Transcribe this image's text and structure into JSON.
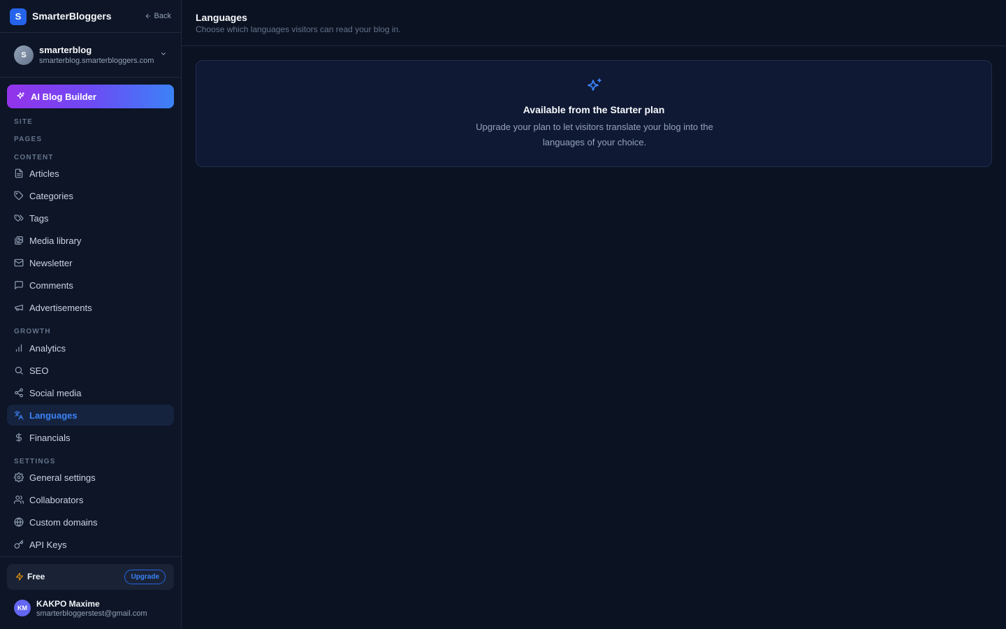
{
  "brand": {
    "logo_letter": "S",
    "name": "SmarterBloggers",
    "back_label": "Back"
  },
  "site": {
    "avatar_letter": "S",
    "name": "smarterblog",
    "domain": "smarterblog.smarterbloggers.com"
  },
  "ai_button": {
    "label": "AI Blog Builder"
  },
  "sections": {
    "site": "SITE",
    "pages": "PAGES",
    "content": "CONTENT",
    "growth": "GROWTH",
    "settings": "SETTINGS"
  },
  "nav": {
    "articles": "Articles",
    "categories": "Categories",
    "tags": "Tags",
    "media": "Media library",
    "newsletter": "Newsletter",
    "comments": "Comments",
    "ads": "Advertisements",
    "analytics": "Analytics",
    "seo": "SEO",
    "social": "Social media",
    "languages": "Languages",
    "financials": "Financials",
    "general": "General settings",
    "collaborators": "Collaborators",
    "domains": "Custom domains",
    "api": "API Keys"
  },
  "plan": {
    "label": "Free",
    "upgrade_label": "Upgrade"
  },
  "user": {
    "initials": "KM",
    "name": "KAKPO Maxime",
    "email": "smarterbloggerstest@gmail.com"
  },
  "header": {
    "title": "Languages",
    "subtitle": "Choose which languages visitors can read your blog in."
  },
  "card": {
    "title": "Available from the Starter plan",
    "text": "Upgrade your plan to let visitors translate your blog into the languages of your choice."
  },
  "colors": {
    "accent": "#3b82f6",
    "background": "#0b1222",
    "sidebar": "#0d1526"
  }
}
